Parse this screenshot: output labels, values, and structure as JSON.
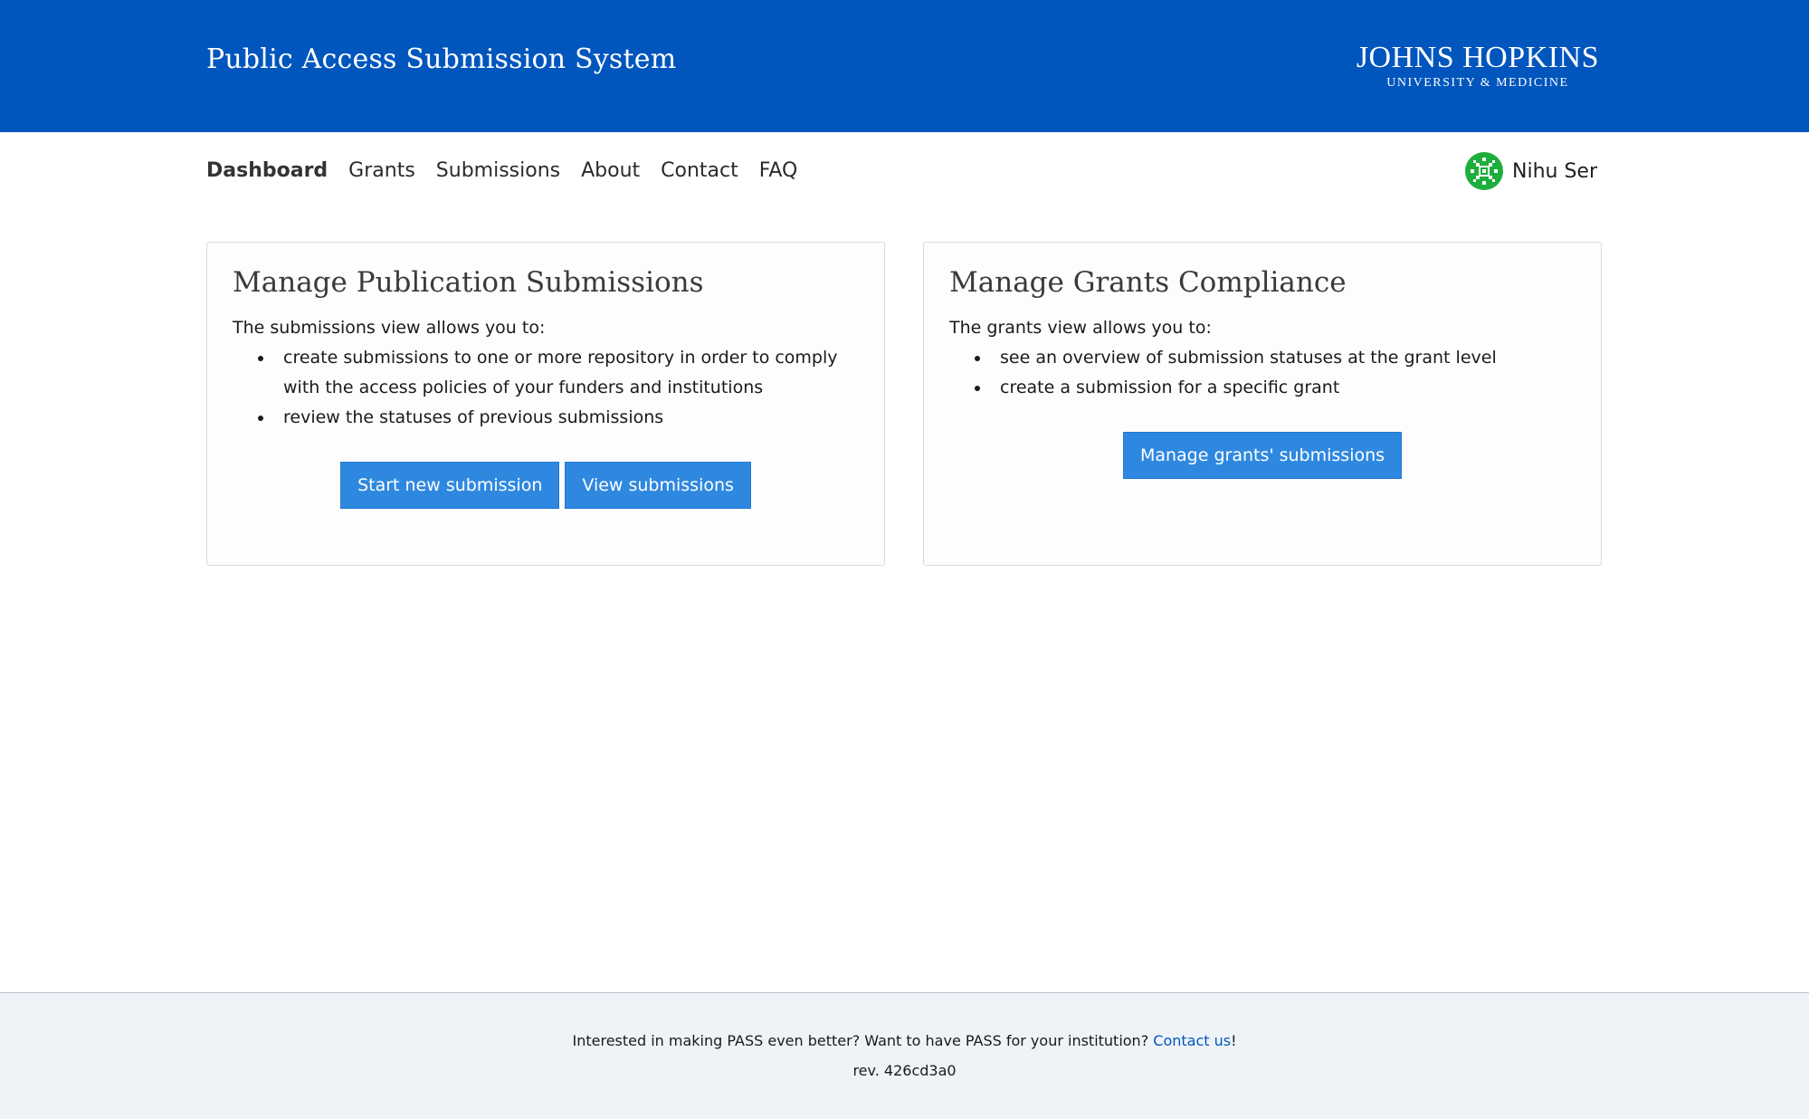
{
  "header": {
    "title": "Public Access Submission System",
    "logo_main": "JOHNS HOPKINS",
    "logo_sub": "UNIVERSITY & MEDICINE",
    "bg_color": "#0056bd"
  },
  "nav": {
    "items": [
      {
        "label": "Dashboard",
        "active": true
      },
      {
        "label": "Grants"
      },
      {
        "label": "Submissions"
      },
      {
        "label": "About"
      },
      {
        "label": "Contact"
      },
      {
        "label": "FAQ"
      }
    ]
  },
  "user": {
    "name": "Nihu Ser",
    "avatar_icon": "avatar-pattern-icon",
    "avatar_color": "#1eae3c"
  },
  "cards": {
    "submissions": {
      "title": "Manage Publication Submissions",
      "intro": "The submissions view allows you to:",
      "bullets": [
        "create submissions to one or more repository in order to comply with the access policies of your funders and institutions",
        "review the statuses of previous submissions"
      ],
      "buttons": [
        "Start new submission",
        "View submissions"
      ]
    },
    "grants": {
      "title": "Manage Grants Compliance",
      "intro": "The grants view allows you to:",
      "bullets": [
        "see an overview of submission statuses at the grant level",
        "create a submission for a specific grant"
      ],
      "buttons": [
        "Manage grants' submissions"
      ]
    }
  },
  "footer": {
    "text": "Interested in making PASS even better? Want to have PASS for your institution?",
    "link": "Contact us",
    "suffix": "!",
    "rev": "rev. 426cd3a0"
  }
}
